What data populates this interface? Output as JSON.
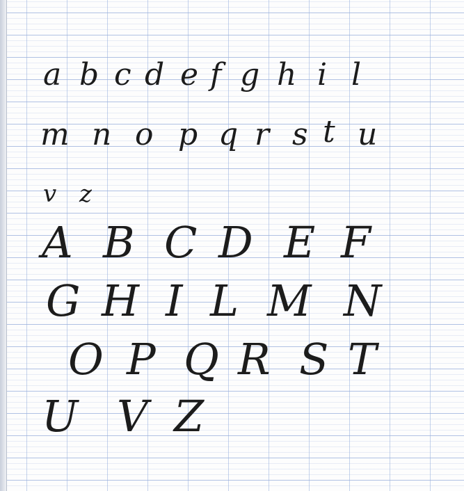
{
  "sheet": {
    "lowercase_row1": [
      "a",
      "b",
      "c",
      "d",
      "e",
      "f",
      "g",
      "h",
      "i",
      "l"
    ],
    "lowercase_row2": [
      "m",
      "n",
      "o",
      "p",
      "q",
      "r",
      "s",
      "t",
      "u"
    ],
    "lowercase_row3": [
      "v",
      "z"
    ],
    "uppercase_row1": [
      "A",
      "B",
      "C",
      "D",
      "E",
      "F"
    ],
    "uppercase_row2": [
      "G",
      "H",
      "I",
      "L",
      "M",
      "N"
    ],
    "uppercase_row3": [
      "O",
      "P",
      "Q",
      "R",
      "S",
      "T"
    ],
    "uppercase_row4": [
      "U",
      "V",
      "Z"
    ]
  }
}
